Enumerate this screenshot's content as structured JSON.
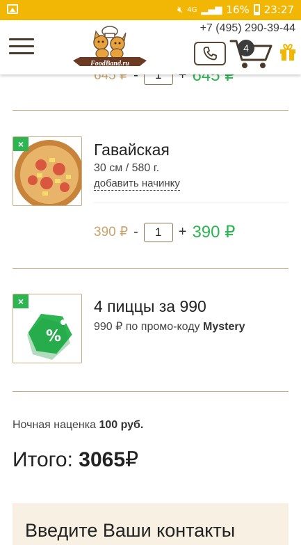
{
  "status_bar": {
    "battery": "16%",
    "time": "23:27",
    "network": "4G"
  },
  "header": {
    "phone": "+7 (495) 290-39-44",
    "logo_text": "FoodBand.ru",
    "cart_count": "4"
  },
  "cart": {
    "partial_item": {
      "old_price": "645 ₽",
      "qty": "1",
      "price": "645 ₽"
    },
    "items": [
      {
        "title": "Гавайская",
        "details": "30 см / 580 г.",
        "add_topping": "добавить начинку",
        "old_price": "390 ₽",
        "qty": "1",
        "price": "390 ₽"
      }
    ],
    "promo": {
      "title": "4 пиццы за 990",
      "price_text": "990 ₽ по промо-коду",
      "code": "Mystery"
    },
    "night_fee_label": "Ночная наценка",
    "night_fee_value": "100 руб.",
    "total_label": "Итого:",
    "total_value": "3065",
    "total_currency": "₽",
    "remove_label": "×"
  },
  "contacts": {
    "title": "Введите Ваши контакты"
  },
  "colors": {
    "accent_yellow": "#f2b705",
    "brand_brown": "#5a4632",
    "price_green": "#2db552",
    "old_price_tan": "#c9a46e"
  },
  "icons": {
    "menu": "hamburger-icon",
    "phone": "phone-icon",
    "cart": "cart-icon",
    "gift": "gift-icon",
    "remove": "close-icon",
    "promo": "discount-tag-icon"
  }
}
